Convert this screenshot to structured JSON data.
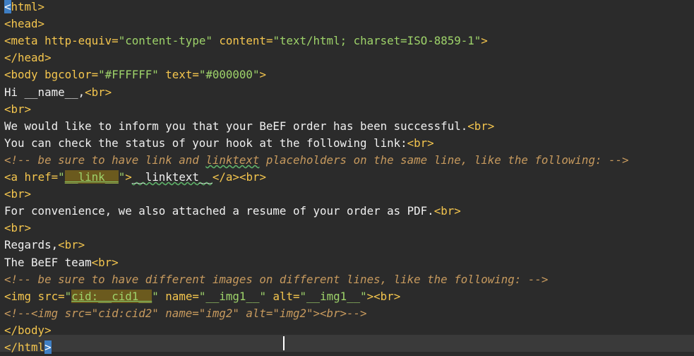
{
  "editor": {
    "lines": [
      {
        "segments": [
          {
            "t": "<",
            "c": "sel"
          },
          {
            "t": "html>",
            "c": "tag"
          }
        ]
      },
      {
        "segments": [
          {
            "t": "<head>",
            "c": "tag"
          }
        ]
      },
      {
        "segments": [
          {
            "t": "<meta ",
            "c": "tag"
          },
          {
            "t": "http-equiv=",
            "c": "attr"
          },
          {
            "t": "\"content-type\"",
            "c": "str"
          },
          {
            "t": " content=",
            "c": "attr"
          },
          {
            "t": "\"text/html; charset=ISO-8859-1\"",
            "c": "str"
          },
          {
            "t": ">",
            "c": "tag"
          }
        ]
      },
      {
        "segments": [
          {
            "t": "</head>",
            "c": "tag"
          }
        ]
      },
      {
        "segments": [
          {
            "t": "<body ",
            "c": "tag"
          },
          {
            "t": "bgcolor=",
            "c": "attr"
          },
          {
            "t": "\"#FFFFFF\"",
            "c": "str"
          },
          {
            "t": " text=",
            "c": "attr"
          },
          {
            "t": "\"#000000\"",
            "c": "str"
          },
          {
            "t": ">",
            "c": "tag"
          }
        ]
      },
      {
        "segments": [
          {
            "t": "Hi __name__,",
            "c": "txt"
          },
          {
            "t": "<br>",
            "c": "tag"
          }
        ]
      },
      {
        "segments": [
          {
            "t": "<br>",
            "c": "tag"
          }
        ]
      },
      {
        "segments": [
          {
            "t": "We would like to inform you that your BeEF order has been successful.",
            "c": "txt"
          },
          {
            "t": "<br>",
            "c": "tag"
          }
        ]
      },
      {
        "segments": [
          {
            "t": "You can check the status of your hook at the following link:",
            "c": "txt"
          },
          {
            "t": "<br>",
            "c": "tag"
          }
        ]
      },
      {
        "segments": [
          {
            "t": "<!-- be sure to have link and ",
            "c": "cmt"
          },
          {
            "t": "linktext",
            "c": "cmt squig"
          },
          {
            "t": " placeholders on the same line, like the following: -->",
            "c": "cmt"
          }
        ]
      },
      {
        "segments": [
          {
            "t": "<a ",
            "c": "tag"
          },
          {
            "t": "href=",
            "c": "attr"
          },
          {
            "t": "\"",
            "c": "str"
          },
          {
            "t": "__link__",
            "c": "str hl"
          },
          {
            "t": "\"",
            "c": "str"
          },
          {
            "t": ">",
            "c": "tag"
          },
          {
            "t": "__linktext__",
            "c": "txt squig"
          },
          {
            "t": "</a>",
            "c": "tag"
          },
          {
            "t": "<br>",
            "c": "tag"
          }
        ]
      },
      {
        "segments": [
          {
            "t": "<br>",
            "c": "tag"
          }
        ]
      },
      {
        "segments": [
          {
            "t": "For convenience, we also attached a resume of your order as PDF.",
            "c": "txt"
          },
          {
            "t": "<br>",
            "c": "tag"
          }
        ]
      },
      {
        "segments": [
          {
            "t": "<br>",
            "c": "tag"
          }
        ]
      },
      {
        "segments": [
          {
            "t": "Regards,",
            "c": "txt"
          },
          {
            "t": "<br>",
            "c": "tag"
          }
        ]
      },
      {
        "segments": [
          {
            "t": "The BeEF team",
            "c": "txt"
          },
          {
            "t": "<br>",
            "c": "tag"
          }
        ]
      },
      {
        "segments": [
          {
            "t": "<!-- be sure to have different images on different lines, like the following: -->",
            "c": "cmt"
          }
        ]
      },
      {
        "segments": [
          {
            "t": "<img ",
            "c": "tag"
          },
          {
            "t": "src=",
            "c": "attr"
          },
          {
            "t": "\"",
            "c": "str"
          },
          {
            "t": "cid:__cid1__",
            "c": "str hl"
          },
          {
            "t": "\"",
            "c": "str"
          },
          {
            "t": " name=",
            "c": "attr"
          },
          {
            "t": "\"__img1__\"",
            "c": "str"
          },
          {
            "t": " alt=",
            "c": "attr"
          },
          {
            "t": "\"__img1__\"",
            "c": "str"
          },
          {
            "t": ">",
            "c": "tag"
          },
          {
            "t": "<br>",
            "c": "tag"
          }
        ]
      },
      {
        "segments": [
          {
            "t": "<!--<img src=\"cid:cid2\" name=\"img2\" alt=\"img2\"><br>-->",
            "c": "cmt"
          }
        ]
      },
      {
        "segments": [
          {
            "t": "</body>",
            "c": "tag"
          }
        ]
      },
      {
        "segments": [
          {
            "t": "</html",
            "c": "tag"
          },
          {
            "t": ">",
            "c": "sel"
          }
        ]
      }
    ]
  }
}
